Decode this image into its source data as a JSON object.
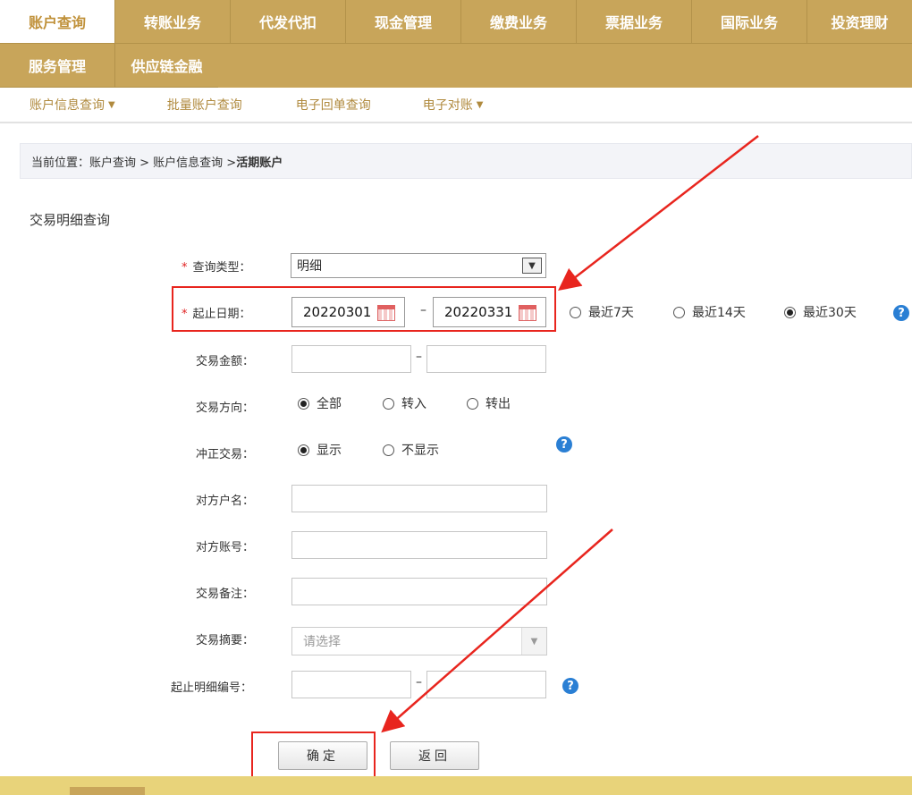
{
  "nav": {
    "row1": [
      "账户查询",
      "转账业务",
      "代发代扣",
      "现金管理",
      "缴费业务",
      "票据业务",
      "国际业务",
      "投资理财"
    ],
    "row2": [
      "服务管理",
      "供应链金融"
    ]
  },
  "subnav": {
    "items": [
      {
        "label": "账户信息查询",
        "has_dropdown": true
      },
      {
        "label": "批量账户查询",
        "has_dropdown": false
      },
      {
        "label": "电子回单查询",
        "has_dropdown": false
      },
      {
        "label": "电子对账",
        "has_dropdown": true
      }
    ]
  },
  "breadcrumb": {
    "prefix": "当前位置：账户查询 > 账户信息查询 > ",
    "current": "活期账户"
  },
  "section_title": "交易明细查询",
  "form": {
    "query_type": {
      "label": "查询类型：",
      "value": "明细",
      "required": true
    },
    "date_range": {
      "label": "起止日期：",
      "start": "20220301",
      "end": "20220331",
      "required": true,
      "sep": "–"
    },
    "quick_range": [
      {
        "label": "最近7天",
        "selected": false
      },
      {
        "label": "最近14天",
        "selected": false
      },
      {
        "label": "最近30天",
        "selected": true
      }
    ],
    "amount": {
      "label": "交易金额：",
      "sep": "–"
    },
    "direction": {
      "label": "交易方向：",
      "options": [
        {
          "label": "全部",
          "selected": true
        },
        {
          "label": "转入",
          "selected": false
        },
        {
          "label": "转出",
          "selected": false
        }
      ]
    },
    "reversal": {
      "label": "冲正交易：",
      "options": [
        {
          "label": "显示",
          "selected": true
        },
        {
          "label": "不显示",
          "selected": false
        }
      ]
    },
    "counterparty_name": {
      "label": "对方户名："
    },
    "counterparty_account": {
      "label": "对方账号："
    },
    "remark": {
      "label": "交易备注："
    },
    "summary": {
      "label": "交易摘要：",
      "placeholder": "请选择"
    },
    "serial_range": {
      "label": "起止明细编号：",
      "sep": "–"
    }
  },
  "buttons": {
    "confirm": "确定",
    "back": "返回"
  },
  "colors": {
    "nav_bg": "#c8a55a",
    "accent": "#b08a3e",
    "highlight": "#e8251e",
    "help": "#2a7fd4"
  }
}
